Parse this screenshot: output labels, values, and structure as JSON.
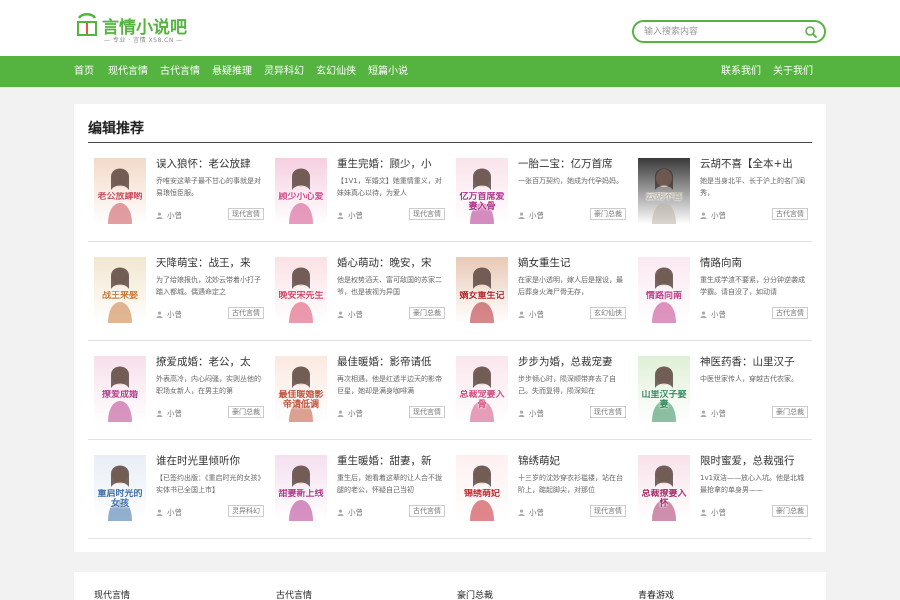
{
  "site": {
    "name": "言情小说吧",
    "tagline": "— 专业 · 言情 XS8.CN —"
  },
  "search": {
    "placeholder": "输入搜索内容"
  },
  "nav": {
    "left": [
      "首页",
      "现代言情",
      "古代言情",
      "悬疑推理",
      "灵异科幻",
      "玄幻仙侠",
      "短篇小说"
    ],
    "right": [
      "联系我们",
      "关于我们"
    ]
  },
  "section": {
    "title": "编辑推荐"
  },
  "books": [
    {
      "title": "误入狼怀：老公放肆",
      "desc": "乔唯安这辈子最不甘心的事就是对易琅恒臣服。",
      "author": "小曾",
      "tag": "现代言情",
      "cover_text": "老公放肆哟",
      "cover_colors": [
        "#f3d9c8",
        "#c84f5a"
      ]
    },
    {
      "title": "重生完婚：顾少，小",
      "desc": "【1V1，军婚文】她重情重义，对妹妹真心以待，为爱人",
      "author": "小曾",
      "tag": "现代言情",
      "cover_text": "顾少小心爱",
      "cover_colors": [
        "#f6cfe0",
        "#d14a8b"
      ]
    },
    {
      "title": "一胎二宝：亿万首席",
      "desc": "一张百万契约，她成为代孕妈妈。",
      "author": "小曾",
      "tag": "豪门总裁",
      "cover_text": "亿万首席爱妻入骨",
      "cover_colors": [
        "#fbe3ec",
        "#b0308a"
      ]
    },
    {
      "title": "云胡不喜【全本+出",
      "desc": "她是当身北平、长于沪上的名门闺秀，",
      "author": "小曾",
      "tag": "古代言情",
      "cover_text": "云胡不喜",
      "cover_colors": [
        "#3a3a3a",
        "#b9b2a6"
      ]
    },
    {
      "title": "天降萌宝：战王，来",
      "desc": "为了给娘报仇，沈妙云带着小打子踏入都城。偶遇命定之",
      "author": "小曾",
      "tag": "古代言情",
      "cover_text": "战王来娶",
      "cover_colors": [
        "#f2e6cf",
        "#c77a3a"
      ]
    },
    {
      "title": "婚心萌动：晚安，宋",
      "desc": "他是权势滔天、富可敌国的苏家二爷，也是被视为异国",
      "author": "小曾",
      "tag": "豪门总裁",
      "cover_text": "晚安宋先生",
      "cover_colors": [
        "#fbe1e6",
        "#d9486b"
      ]
    },
    {
      "title": "嫡女重生记",
      "desc": "在家是小透明，嫁人后是摆设，最后葬身火海尸骨无存，",
      "author": "小曾",
      "tag": "玄幻仙侠",
      "cover_text": "嫡女重生记",
      "cover_colors": [
        "#e9c9b6",
        "#b3262b"
      ]
    },
    {
      "title": "情路向南",
      "desc": "重生成学渣不要紧，分分钟逆袭成学霸。请自没了，如动请",
      "author": "小曾",
      "tag": "古代言情",
      "cover_text": "情路向南",
      "cover_colors": [
        "#fbe8f2",
        "#c13d8a"
      ]
    },
    {
      "title": "撩爱成婚：老公，太",
      "desc": "外表高冷，内心闷骚，实则丛他的职场女新人，在男主的第",
      "author": "小曾",
      "tag": "豪门总裁",
      "cover_text": "撩爱成婚",
      "cover_colors": [
        "#f7dfeb",
        "#b83e8c"
      ]
    },
    {
      "title": "最佳暖婚：影帝请低",
      "desc": "再次相遇，他是红透半边天的影帝巨星，她却是满身咖啡满",
      "author": "小曾",
      "tag": "现代言情",
      "cover_text": "最佳暖婚影帝请低调",
      "cover_colors": [
        "#fbe9e0",
        "#c0533b"
      ]
    },
    {
      "title": "步步为婚，总裁宠妻",
      "desc": "步步倾心时，陨深顺带弃去了自己。失而复得，陨深知在",
      "author": "小曾",
      "tag": "现代言情",
      "cover_text": "总裁宠妻入骨",
      "cover_colors": [
        "#fbe6ee",
        "#d04e7f"
      ]
    },
    {
      "title": "神医药香：山里汉子",
      "desc": "中医世家传人，穿越古代农家。",
      "author": "小曾",
      "tag": "豪门总裁",
      "cover_text": "山里汉子娶妻",
      "cover_colors": [
        "#dff0d6",
        "#2e8a5a"
      ]
    },
    {
      "title": "谁在时光里倾听你",
      "desc": "【已签约出版：《重启时光的女孩》实体书已全国上市】",
      "author": "小曾",
      "tag": "灵异科幻",
      "cover_text": "重启时光的女孩",
      "cover_colors": [
        "#e7eef5",
        "#3b6ea5"
      ]
    },
    {
      "title": "重生暖婚：甜妻，新",
      "desc": "重生后，她看着这辈的让人合不拢腿的老公，怀疑自己当初",
      "author": "小曾",
      "tag": "古代言情",
      "cover_text": "甜妻新上线",
      "cover_colors": [
        "#f5dff0",
        "#b3398f"
      ]
    },
    {
      "title": "锦绣萌妃",
      "desc": "十三岁的沈妙穿衣衫褴褛，站在台阶上，踮起脚尖，对那位",
      "author": "小曾",
      "tag": "现代言情",
      "cover_text": "锦绣萌妃",
      "cover_colors": [
        "#fff0f0",
        "#c4252e"
      ]
    },
    {
      "title": "限时蜜爱，总裁强行",
      "desc": "1v1双洁——放心入坑。他是北城最抢拿的单身男——",
      "author": "小曾",
      "tag": "豪门总裁",
      "cover_text": "总裁撩妻入怀",
      "cover_colors": [
        "#f8e2ea",
        "#a8326c"
      ]
    }
  ],
  "bottom_categories": [
    "现代言情",
    "古代言情",
    "豪门总裁",
    "青春游戏"
  ]
}
